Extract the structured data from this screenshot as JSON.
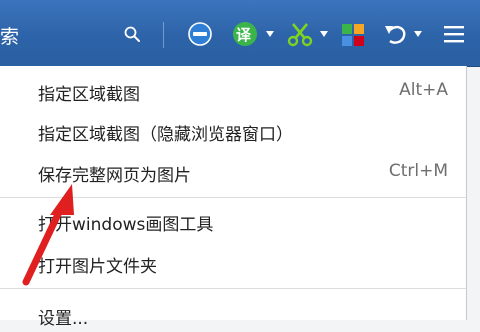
{
  "toolbar": {
    "search_label": "索",
    "icons": [
      "search-icon",
      "ie-compat-icon",
      "translate-icon",
      "scissors-icon",
      "apps-icon",
      "undo-icon",
      "hamburger-menu-icon"
    ],
    "translate_glyph": "译"
  },
  "menu": {
    "items": [
      {
        "label": "指定区域截图",
        "shortcut": "Alt+A"
      },
      {
        "label": "指定区域截图（隐藏浏览器窗口）",
        "shortcut": ""
      },
      {
        "label": "保存完整网页为图片",
        "shortcut": "Ctrl+M"
      },
      {
        "label": "打开windows画图工具",
        "shortcut": ""
      },
      {
        "label": "打开图片文件夹",
        "shortcut": ""
      },
      {
        "label": "设置...",
        "shortcut": ""
      }
    ]
  },
  "colors": {
    "toolbar": "#2d63a8",
    "accent_green": "#3bb54a",
    "annotation_arrow": "#e02020"
  }
}
